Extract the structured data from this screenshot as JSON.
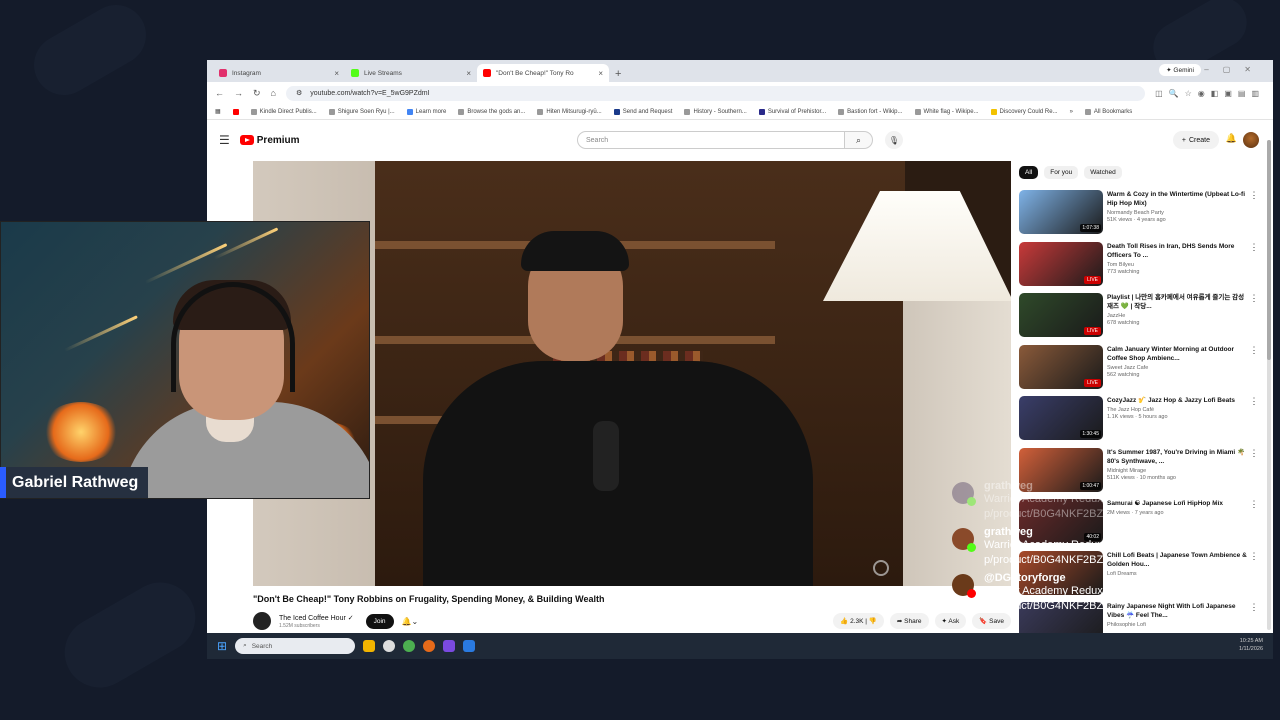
{
  "browser": {
    "tabs": [
      {
        "label": "Instagram",
        "color": "#e1306c"
      },
      {
        "label": "Live Streams",
        "color": "#53fc18"
      },
      {
        "label": "\"Don't Be Cheap!\" Tony Ro",
        "color": "#ff0000"
      }
    ],
    "gemini_label": "Gemini",
    "url": "youtube.com/watch?v=E_5wG9PZdmI",
    "bookmarks": [
      "Kindle Direct Publis...",
      "Shigure Soen Ryu |...",
      "Learn more",
      "Browse the gods an...",
      "Hiten Mitsurugi-ryū...",
      "Send and Request",
      "History - Southern...",
      "Survival of Prehistor...",
      "Bastion fort - Wikip...",
      "White flag - Wikipe...",
      "Discovery Could Re..."
    ],
    "all_bookmarks": "All Bookmarks"
  },
  "youtube": {
    "logo_text": "Premium",
    "search_placeholder": "Search",
    "create_label": "Create",
    "video_title": "\"Don't Be Cheap!\" Tony Robbins on Frugality, Spending Money, & Building Wealth",
    "channel_name": "The Iced Coffee Hour",
    "subscribers": "1.52M subscribers",
    "join_label": "Join",
    "like_count": "2.3K",
    "share_label": "Share",
    "ask_label": "Ask",
    "save_label": "Save",
    "chips": [
      "All",
      "For you",
      "Watched"
    ],
    "recommendations": [
      {
        "title": "Warm & Cozy in the Wintertime (Upbeat Lo-fi Hip Hop Mix)",
        "channel": "Normandy Beach Party",
        "stats": "51K views · 4 years ago",
        "badge": "1:07:38",
        "live": false,
        "color": "#7fb3e8"
      },
      {
        "title": "Death Toll Rises in Iran, DHS Sends More Officers To ...",
        "channel": "Tom Bilyeu",
        "stats": "773 watching",
        "badge": "LIVE",
        "live": true,
        "color": "#c83a3a"
      },
      {
        "title": "Playlist | 나만의 홈카페에서 여유롭게 즐기는 감성 재즈 💚 | 작당...",
        "channel": "JazzHe",
        "stats": "678 watching",
        "badge": "LIVE",
        "live": true,
        "color": "#2f4a2a"
      },
      {
        "title": "Calm January Winter Morning at Outdoor Coffee Shop Ambienc...",
        "channel": "Sweet Jazz Cafe",
        "stats": "562 watching",
        "badge": "LIVE",
        "live": true,
        "color": "#8a5a3a"
      },
      {
        "title": "CozyJazz 🎷 Jazz Hop & Jazzy Lofi Beats",
        "channel": "The Jazz Hop Café",
        "stats": "1.1K views · 5 hours ago",
        "badge": "1:30:45",
        "live": false,
        "color": "#3a3e6a"
      },
      {
        "title": "It's Summer 1987, You're Driving in Miami 🌴 80's Synthwave, ...",
        "channel": "Midnight Mirage",
        "stats": "511K views · 10 months ago",
        "badge": "1:00:47",
        "live": false,
        "color": "#d2603a"
      },
      {
        "title": "Samurai ☯ Japanese Lofi HipHop Mix",
        "channel": "",
        "stats": "2M views · 7 years ago",
        "badge": "40:02",
        "live": false,
        "color": "#6a2a2a"
      },
      {
        "title": "Chill Lofi Beats | Japanese Town Ambience & Golden Hou...",
        "channel": "Lofi Dreams",
        "stats": "",
        "badge": "",
        "live": false,
        "color": "#a84a2a"
      },
      {
        "title": "Rainy Japanese Night With Lofi Japanese Vibes ☔ Feel The...",
        "channel": "Philosophie Lofi",
        "stats": "",
        "badge": "",
        "live": false,
        "color": "#3a3a5a"
      }
    ]
  },
  "taskbar": {
    "search_placeholder": "Search",
    "time": "10:25 AM",
    "date": "1/11/2026"
  },
  "webcam": {
    "streamer_name": "Gabriel Rathweg"
  },
  "chat": [
    {
      "user": "grathweg",
      "text": "Warrior Academy Redux - https://www.amazon.com/gp/product/B0G4NKF2BZ/",
      "faded": true,
      "avatar_color": "#5a4a6a",
      "badge_color": "#53fc18"
    },
    {
      "user": "grathweg",
      "text": "Warrior Academy Redux - https://www.amazon.com/gp/product/B0G4NKF2BZ/",
      "faded": false,
      "avatar_color": "#8a4a2a",
      "badge_color": "#53fc18"
    },
    {
      "user": "@DGstoryforge",
      "text": "Warrior Academy Redux - https://www.amazon.com/gp/product/B0G4NKF2BZ/",
      "faded": false,
      "avatar_color": "#6a3a1a",
      "badge_color": "#ff0000"
    }
  ]
}
